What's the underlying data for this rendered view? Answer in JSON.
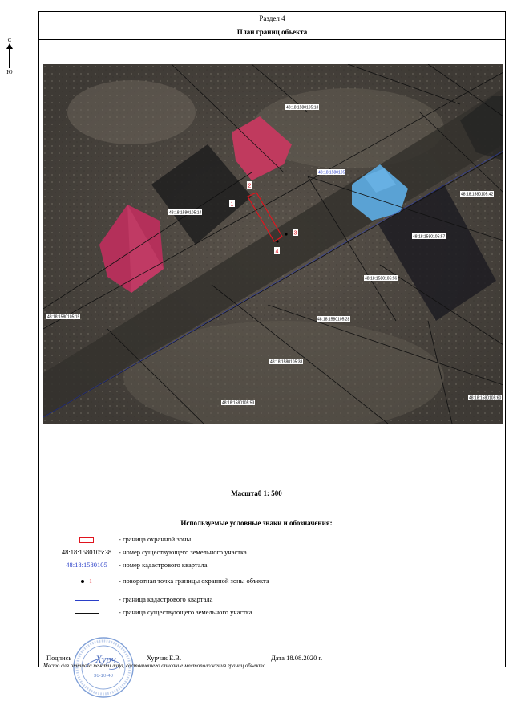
{
  "header": {
    "section": "Раздел 4",
    "title": "План границ объекта"
  },
  "compass": {
    "north": "С",
    "south": "Ю"
  },
  "map": {
    "points": [
      "1",
      "2",
      "3",
      "4"
    ],
    "parcels": [
      "48:18:1580105:13",
      "48:18:1580105:14",
      "48:18:1580105:42",
      "48:18:1580105:57",
      "48:18:1580105:56",
      "48:18:1580105:15",
      "48:18:1580105:28",
      "48:18:1580105:38",
      "48:18:1580105:53",
      "48:18:1580105:60"
    ],
    "quarter": "48:18:1580105"
  },
  "scale": "Масштаб 1: 500",
  "legend": {
    "title": "Используемые условные знаки и обозначения:",
    "items": [
      {
        "symbol": "",
        "text": "- граница  охранной зоны"
      },
      {
        "symbol": "48:18:1580105:38",
        "text": "- номер существующего земельного участка"
      },
      {
        "symbol": "48:18:1580105",
        "text": "- номер кадастрового квартала"
      },
      {
        "symbol": "1",
        "text": "- поворотная точка границы охранной зоны объекта"
      },
      {
        "symbol": "",
        "text": "- граница кадастрового квартала"
      },
      {
        "symbol": "",
        "text": "- граница существующего земельного участка"
      }
    ]
  },
  "signature": {
    "label": "Подпись",
    "name": "Хурчак Е.В.",
    "date": "Дата 18.08.2020 г.",
    "note": "Место для оттиска печати лица, составившего описание местоположения границ объекта",
    "stamp_text": "36-10-40",
    "signature_text": "Хурч"
  },
  "colors": {
    "zone": "#e0141e",
    "quarter": "#2a3fc8",
    "parcel_line": "#111111"
  }
}
